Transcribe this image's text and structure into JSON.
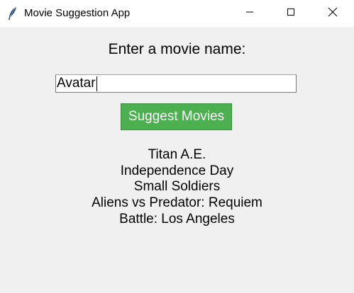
{
  "window": {
    "title": "Movie Suggestion App",
    "controls": [
      "minimize-icon",
      "maximize-icon",
      "close-icon"
    ]
  },
  "form": {
    "prompt": "Enter a movie name:",
    "movie_input_value": "Avatar",
    "button_label": "Suggest Movies",
    "button_color": "#4caf50",
    "button_text_color": "#ffffff"
  },
  "results": [
    "Titan A.E.",
    "Independence Day",
    "Small Soldiers",
    "Aliens vs Predator: Requiem",
    "Battle: Los Angeles"
  ]
}
